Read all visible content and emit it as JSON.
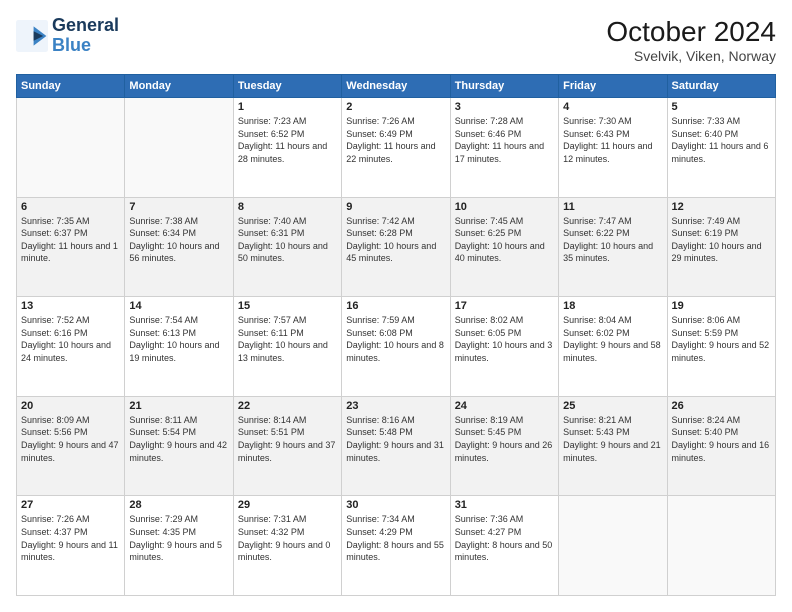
{
  "header": {
    "logo_line1": "General",
    "logo_line2": "Blue",
    "title": "October 2024",
    "subtitle": "Svelvik, Viken, Norway"
  },
  "weekdays": [
    "Sunday",
    "Monday",
    "Tuesday",
    "Wednesday",
    "Thursday",
    "Friday",
    "Saturday"
  ],
  "weeks": [
    [
      {
        "day": null
      },
      {
        "day": null
      },
      {
        "day": "1",
        "sunrise": "Sunrise: 7:23 AM",
        "sunset": "Sunset: 6:52 PM",
        "daylight": "Daylight: 11 hours and 28 minutes."
      },
      {
        "day": "2",
        "sunrise": "Sunrise: 7:26 AM",
        "sunset": "Sunset: 6:49 PM",
        "daylight": "Daylight: 11 hours and 22 minutes."
      },
      {
        "day": "3",
        "sunrise": "Sunrise: 7:28 AM",
        "sunset": "Sunset: 6:46 PM",
        "daylight": "Daylight: 11 hours and 17 minutes."
      },
      {
        "day": "4",
        "sunrise": "Sunrise: 7:30 AM",
        "sunset": "Sunset: 6:43 PM",
        "daylight": "Daylight: 11 hours and 12 minutes."
      },
      {
        "day": "5",
        "sunrise": "Sunrise: 7:33 AM",
        "sunset": "Sunset: 6:40 PM",
        "daylight": "Daylight: 11 hours and 6 minutes."
      }
    ],
    [
      {
        "day": "6",
        "sunrise": "Sunrise: 7:35 AM",
        "sunset": "Sunset: 6:37 PM",
        "daylight": "Daylight: 11 hours and 1 minute."
      },
      {
        "day": "7",
        "sunrise": "Sunrise: 7:38 AM",
        "sunset": "Sunset: 6:34 PM",
        "daylight": "Daylight: 10 hours and 56 minutes."
      },
      {
        "day": "8",
        "sunrise": "Sunrise: 7:40 AM",
        "sunset": "Sunset: 6:31 PM",
        "daylight": "Daylight: 10 hours and 50 minutes."
      },
      {
        "day": "9",
        "sunrise": "Sunrise: 7:42 AM",
        "sunset": "Sunset: 6:28 PM",
        "daylight": "Daylight: 10 hours and 45 minutes."
      },
      {
        "day": "10",
        "sunrise": "Sunrise: 7:45 AM",
        "sunset": "Sunset: 6:25 PM",
        "daylight": "Daylight: 10 hours and 40 minutes."
      },
      {
        "day": "11",
        "sunrise": "Sunrise: 7:47 AM",
        "sunset": "Sunset: 6:22 PM",
        "daylight": "Daylight: 10 hours and 35 minutes."
      },
      {
        "day": "12",
        "sunrise": "Sunrise: 7:49 AM",
        "sunset": "Sunset: 6:19 PM",
        "daylight": "Daylight: 10 hours and 29 minutes."
      }
    ],
    [
      {
        "day": "13",
        "sunrise": "Sunrise: 7:52 AM",
        "sunset": "Sunset: 6:16 PM",
        "daylight": "Daylight: 10 hours and 24 minutes."
      },
      {
        "day": "14",
        "sunrise": "Sunrise: 7:54 AM",
        "sunset": "Sunset: 6:13 PM",
        "daylight": "Daylight: 10 hours and 19 minutes."
      },
      {
        "day": "15",
        "sunrise": "Sunrise: 7:57 AM",
        "sunset": "Sunset: 6:11 PM",
        "daylight": "Daylight: 10 hours and 13 minutes."
      },
      {
        "day": "16",
        "sunrise": "Sunrise: 7:59 AM",
        "sunset": "Sunset: 6:08 PM",
        "daylight": "Daylight: 10 hours and 8 minutes."
      },
      {
        "day": "17",
        "sunrise": "Sunrise: 8:02 AM",
        "sunset": "Sunset: 6:05 PM",
        "daylight": "Daylight: 10 hours and 3 minutes."
      },
      {
        "day": "18",
        "sunrise": "Sunrise: 8:04 AM",
        "sunset": "Sunset: 6:02 PM",
        "daylight": "Daylight: 9 hours and 58 minutes."
      },
      {
        "day": "19",
        "sunrise": "Sunrise: 8:06 AM",
        "sunset": "Sunset: 5:59 PM",
        "daylight": "Daylight: 9 hours and 52 minutes."
      }
    ],
    [
      {
        "day": "20",
        "sunrise": "Sunrise: 8:09 AM",
        "sunset": "Sunset: 5:56 PM",
        "daylight": "Daylight: 9 hours and 47 minutes."
      },
      {
        "day": "21",
        "sunrise": "Sunrise: 8:11 AM",
        "sunset": "Sunset: 5:54 PM",
        "daylight": "Daylight: 9 hours and 42 minutes."
      },
      {
        "day": "22",
        "sunrise": "Sunrise: 8:14 AM",
        "sunset": "Sunset: 5:51 PM",
        "daylight": "Daylight: 9 hours and 37 minutes."
      },
      {
        "day": "23",
        "sunrise": "Sunrise: 8:16 AM",
        "sunset": "Sunset: 5:48 PM",
        "daylight": "Daylight: 9 hours and 31 minutes."
      },
      {
        "day": "24",
        "sunrise": "Sunrise: 8:19 AM",
        "sunset": "Sunset: 5:45 PM",
        "daylight": "Daylight: 9 hours and 26 minutes."
      },
      {
        "day": "25",
        "sunrise": "Sunrise: 8:21 AM",
        "sunset": "Sunset: 5:43 PM",
        "daylight": "Daylight: 9 hours and 21 minutes."
      },
      {
        "day": "26",
        "sunrise": "Sunrise: 8:24 AM",
        "sunset": "Sunset: 5:40 PM",
        "daylight": "Daylight: 9 hours and 16 minutes."
      }
    ],
    [
      {
        "day": "27",
        "sunrise": "Sunrise: 7:26 AM",
        "sunset": "Sunset: 4:37 PM",
        "daylight": "Daylight: 9 hours and 11 minutes."
      },
      {
        "day": "28",
        "sunrise": "Sunrise: 7:29 AM",
        "sunset": "Sunset: 4:35 PM",
        "daylight": "Daylight: 9 hours and 5 minutes."
      },
      {
        "day": "29",
        "sunrise": "Sunrise: 7:31 AM",
        "sunset": "Sunset: 4:32 PM",
        "daylight": "Daylight: 9 hours and 0 minutes."
      },
      {
        "day": "30",
        "sunrise": "Sunrise: 7:34 AM",
        "sunset": "Sunset: 4:29 PM",
        "daylight": "Daylight: 8 hours and 55 minutes."
      },
      {
        "day": "31",
        "sunrise": "Sunrise: 7:36 AM",
        "sunset": "Sunset: 4:27 PM",
        "daylight": "Daylight: 8 hours and 50 minutes."
      },
      {
        "day": null
      },
      {
        "day": null
      }
    ]
  ]
}
